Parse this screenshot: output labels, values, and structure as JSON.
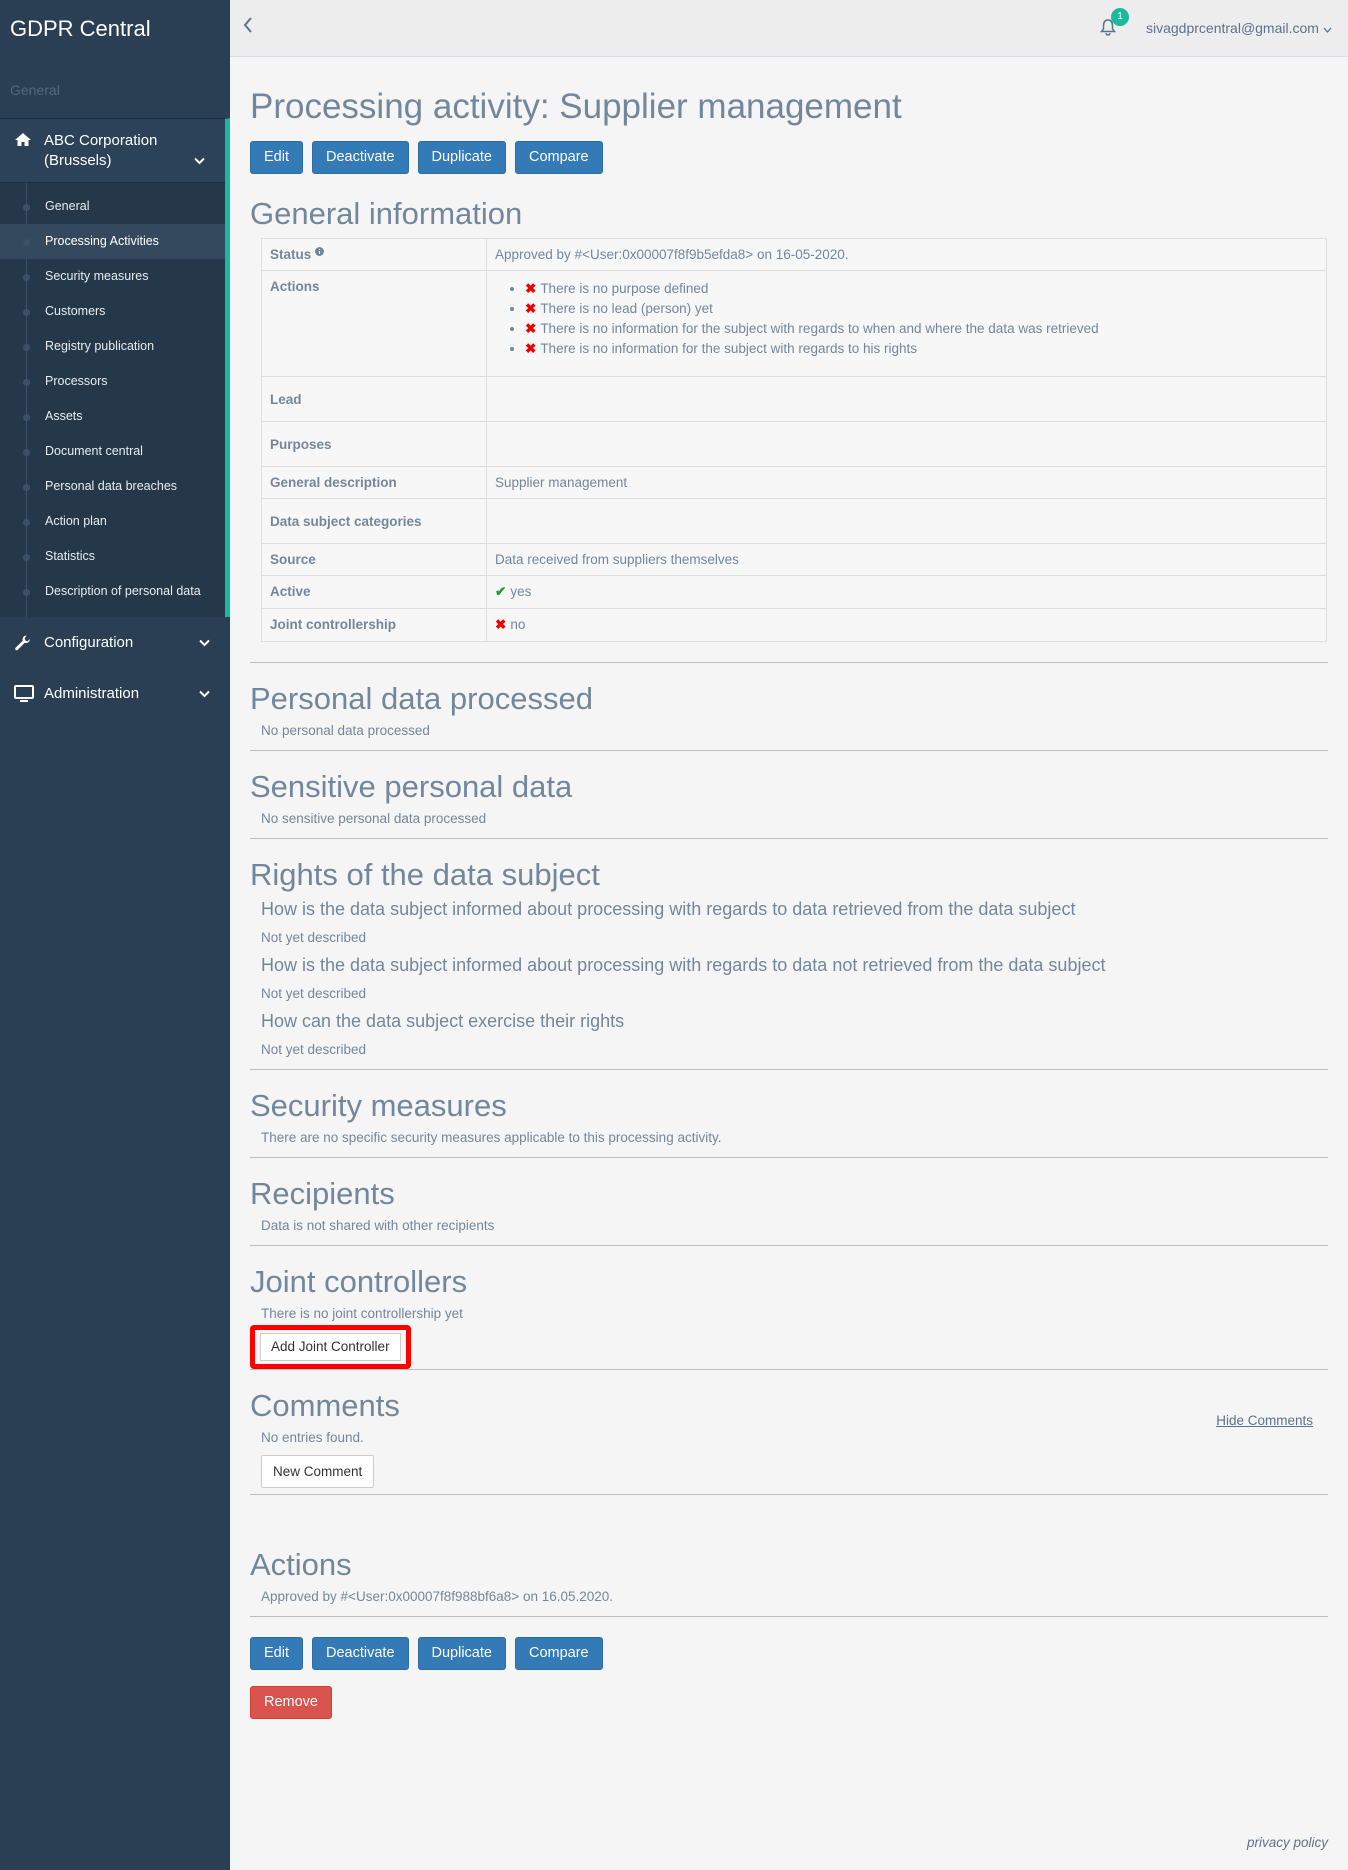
{
  "sidebar": {
    "brand": "GDPR Central",
    "section": "General",
    "org": "ABC Corporation (Brussels)",
    "items": [
      "General",
      "Processing Activities",
      "Security measures",
      "Customers",
      "Registry publication",
      "Processors",
      "Assets",
      "Document central",
      "Personal data breaches",
      "Action plan",
      "Statistics",
      "Description of personal data"
    ],
    "configuration": "Configuration",
    "administration": "Administration"
  },
  "topbar": {
    "notification_count": "1",
    "user_email": "sivagdprcentral@gmail.com"
  },
  "page": {
    "title": "Processing activity: Supplier management",
    "buttons": {
      "edit": "Edit",
      "deactivate": "Deactivate",
      "duplicate": "Duplicate",
      "compare": "Compare",
      "remove": "Remove"
    }
  },
  "general_info": {
    "heading": "General information",
    "status_label": "Status",
    "status_value": "Approved by #<User:0x00007f8f9b5efda8> on 16-05-2020.",
    "actions_label": "Actions",
    "actions": [
      "There is no purpose defined",
      "There is no lead (person) yet",
      "There is no information for the subject with regards to when and where the data was retrieved",
      "There is no information for the subject with regards to his rights"
    ],
    "lead_label": "Lead",
    "purposes_label": "Purposes",
    "description_label": "General description",
    "description_value": "Supplier management",
    "categories_label": "Data subject categories",
    "source_label": "Source",
    "source_value": "Data received from suppliers themselves",
    "active_label": "Active",
    "active_value": "yes",
    "joint_label": "Joint controllership",
    "joint_value": "no"
  },
  "personal_data": {
    "heading": "Personal data processed",
    "text": "No personal data processed"
  },
  "sensitive_data": {
    "heading": "Sensitive personal data",
    "text": "No sensitive personal data processed"
  },
  "rights": {
    "heading": "Rights of the data subject",
    "q1": "How is the data subject informed about processing with regards to data retrieved from the data subject",
    "a1": "Not yet described",
    "q2": "How is the data subject informed about processing with regards to data not retrieved from the data subject",
    "a2": "Not yet described",
    "q3": "How can the data subject exercise their rights",
    "a3": "Not yet described"
  },
  "security": {
    "heading": "Security measures",
    "text": "There are no specific security measures applicable to this processing activity."
  },
  "recipients": {
    "heading": "Recipients",
    "text": "Data is not shared with other recipients"
  },
  "joint_controllers": {
    "heading": "Joint controllers",
    "text": "There is no joint controllership yet",
    "add_button": "Add Joint Controller"
  },
  "comments": {
    "heading": "Comments",
    "hide_link": "Hide Comments",
    "empty": "No entries found.",
    "new_button": "New Comment"
  },
  "actions_section": {
    "heading": "Actions",
    "text": "Approved by #<User:0x00007f8f988bf6a8> on 16.05.2020."
  },
  "footer": {
    "privacy": "privacy policy"
  },
  "colors": {
    "sidebar": "#2a3f54",
    "accent": "#1abb9c",
    "primary": "#337ab7",
    "danger": "#d9534f",
    "highlight": "#ff0000"
  }
}
